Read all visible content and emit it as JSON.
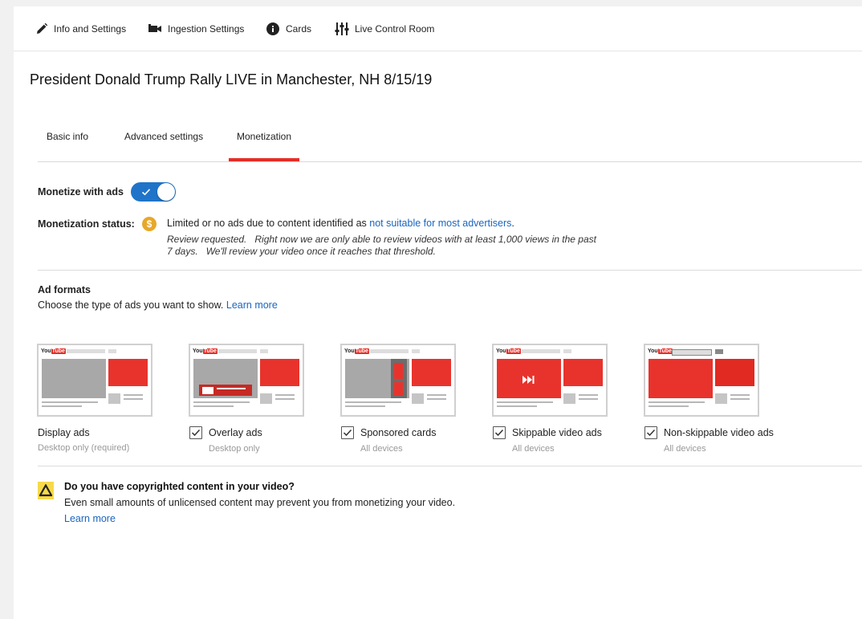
{
  "toolbar": {
    "info_settings": "Info and Settings",
    "ingestion_settings": "Ingestion Settings",
    "cards": "Cards",
    "live_control_room": "Live Control Room"
  },
  "video_title": "President Donald Trump Rally LIVE in Manchester, NH 8/15/19",
  "tabs": {
    "basic_info": "Basic info",
    "advanced_settings": "Advanced settings",
    "monetization": "Monetization",
    "active": "Monetization"
  },
  "monetize": {
    "label": "Monetize with ads",
    "enabled": true
  },
  "status": {
    "label": "Monetization status:",
    "icon": "dollar-coin-icon",
    "icon_color": "#e7a82a",
    "main_text": "Limited or no ads due to content identified as ",
    "link_text": "not suitable for most advertisers",
    "main_suffix": ".",
    "note": "Review requested.   Right now we are only able to review videos with at least 1,000 views in the past 7 days.   We'll review your video once it reaches that threshold."
  },
  "ad_formats": {
    "title": "Ad formats",
    "subtitle": "Choose the type of ads you want to show. ",
    "learn_more": "Learn more",
    "items": [
      {
        "name": "Display ads",
        "note": "Desktop only (required)",
        "checked": null
      },
      {
        "name": "Overlay ads",
        "note": "Desktop only",
        "checked": true
      },
      {
        "name": "Sponsored cards",
        "note": "All devices",
        "checked": true
      },
      {
        "name": "Skippable video ads",
        "note": "All devices",
        "checked": true
      },
      {
        "name": "Non-skippable video ads",
        "note": "All devices",
        "checked": true
      }
    ],
    "thumb_logo": "You",
    "thumb_logo_tube": "Tube"
  },
  "copyright": {
    "title": "Do you have copyrighted content in your video?",
    "text": "Even small amounts of unlicensed content may prevent you from monetizing your video.",
    "learn_more": "Learn more",
    "icon": "warning-icon"
  },
  "colors": {
    "accent_red": "#e52d27",
    "toggle_blue": "#1f74c9",
    "link_blue": "#1a65c0",
    "warning_yellow": "#f6d94a"
  }
}
